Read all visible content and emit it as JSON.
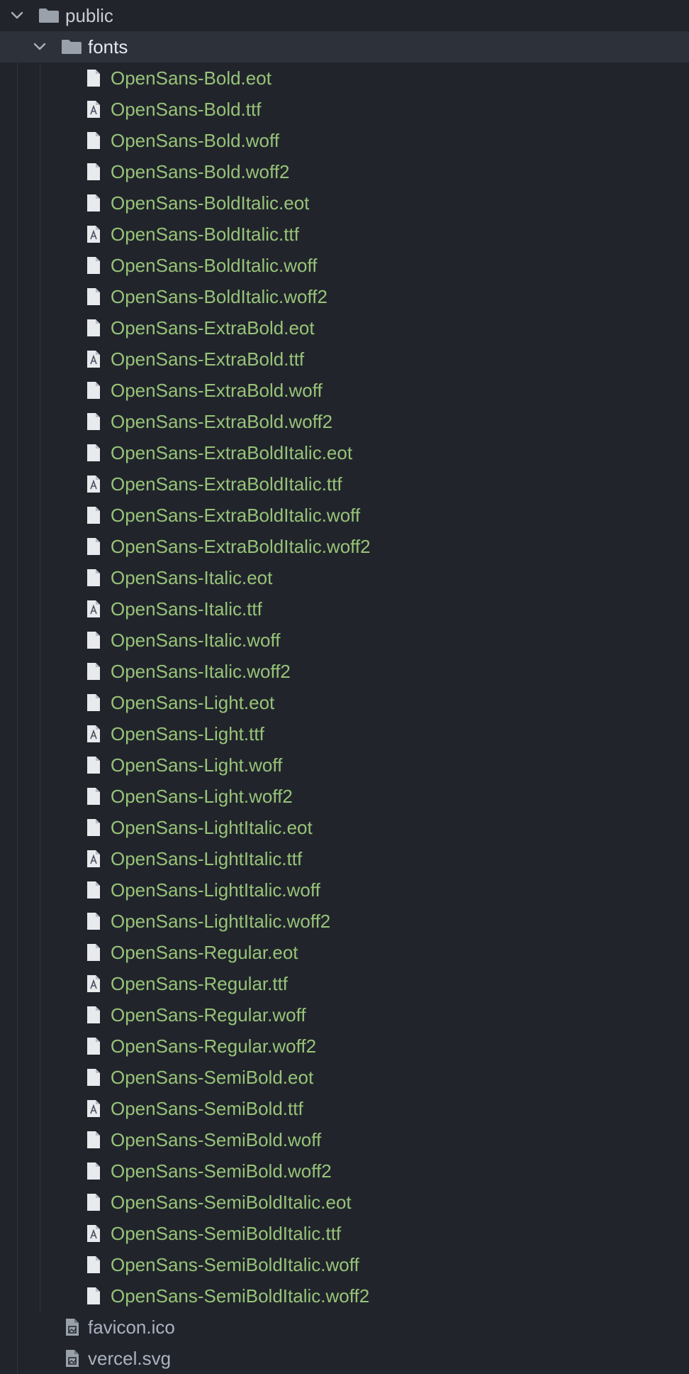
{
  "tree": {
    "root": {
      "label": "public",
      "expanded": true,
      "icon": "folder-icon"
    },
    "folder": {
      "label": "fonts",
      "expanded": true,
      "icon": "folder-icon"
    },
    "font_files": [
      {
        "name": "OpenSans-Bold.eot",
        "icon": "file-icon"
      },
      {
        "name": "OpenSans-Bold.ttf",
        "icon": "font-file-icon"
      },
      {
        "name": "OpenSans-Bold.woff",
        "icon": "file-icon"
      },
      {
        "name": "OpenSans-Bold.woff2",
        "icon": "file-icon"
      },
      {
        "name": "OpenSans-BoldItalic.eot",
        "icon": "file-icon"
      },
      {
        "name": "OpenSans-BoldItalic.ttf",
        "icon": "font-file-icon"
      },
      {
        "name": "OpenSans-BoldItalic.woff",
        "icon": "file-icon"
      },
      {
        "name": "OpenSans-BoldItalic.woff2",
        "icon": "file-icon"
      },
      {
        "name": "OpenSans-ExtraBold.eot",
        "icon": "file-icon"
      },
      {
        "name": "OpenSans-ExtraBold.ttf",
        "icon": "font-file-icon"
      },
      {
        "name": "OpenSans-ExtraBold.woff",
        "icon": "file-icon"
      },
      {
        "name": "OpenSans-ExtraBold.woff2",
        "icon": "file-icon"
      },
      {
        "name": "OpenSans-ExtraBoldItalic.eot",
        "icon": "file-icon"
      },
      {
        "name": "OpenSans-ExtraBoldItalic.ttf",
        "icon": "font-file-icon"
      },
      {
        "name": "OpenSans-ExtraBoldItalic.woff",
        "icon": "file-icon"
      },
      {
        "name": "OpenSans-ExtraBoldItalic.woff2",
        "icon": "file-icon"
      },
      {
        "name": "OpenSans-Italic.eot",
        "icon": "file-icon"
      },
      {
        "name": "OpenSans-Italic.ttf",
        "icon": "font-file-icon"
      },
      {
        "name": "OpenSans-Italic.woff",
        "icon": "file-icon"
      },
      {
        "name": "OpenSans-Italic.woff2",
        "icon": "file-icon"
      },
      {
        "name": "OpenSans-Light.eot",
        "icon": "file-icon"
      },
      {
        "name": "OpenSans-Light.ttf",
        "icon": "font-file-icon"
      },
      {
        "name": "OpenSans-Light.woff",
        "icon": "file-icon"
      },
      {
        "name": "OpenSans-Light.woff2",
        "icon": "file-icon"
      },
      {
        "name": "OpenSans-LightItalic.eot",
        "icon": "file-icon"
      },
      {
        "name": "OpenSans-LightItalic.ttf",
        "icon": "font-file-icon"
      },
      {
        "name": "OpenSans-LightItalic.woff",
        "icon": "file-icon"
      },
      {
        "name": "OpenSans-LightItalic.woff2",
        "icon": "file-icon"
      },
      {
        "name": "OpenSans-Regular.eot",
        "icon": "file-icon"
      },
      {
        "name": "OpenSans-Regular.ttf",
        "icon": "font-file-icon"
      },
      {
        "name": "OpenSans-Regular.woff",
        "icon": "file-icon"
      },
      {
        "name": "OpenSans-Regular.woff2",
        "icon": "file-icon"
      },
      {
        "name": "OpenSans-SemiBold.eot",
        "icon": "file-icon"
      },
      {
        "name": "OpenSans-SemiBold.ttf",
        "icon": "font-file-icon"
      },
      {
        "name": "OpenSans-SemiBold.woff",
        "icon": "file-icon"
      },
      {
        "name": "OpenSans-SemiBold.woff2",
        "icon": "file-icon"
      },
      {
        "name": "OpenSans-SemiBoldItalic.eot",
        "icon": "file-icon"
      },
      {
        "name": "OpenSans-SemiBoldItalic.ttf",
        "icon": "font-file-icon"
      },
      {
        "name": "OpenSans-SemiBoldItalic.woff",
        "icon": "file-icon"
      },
      {
        "name": "OpenSans-SemiBoldItalic.woff2",
        "icon": "file-icon"
      }
    ],
    "public_files": [
      {
        "name": "favicon.ico",
        "icon": "image-file-icon"
      },
      {
        "name": "vercel.svg",
        "icon": "image-file-icon"
      }
    ]
  },
  "colors": {
    "background": "#21252b",
    "selected_row": "#2c313a",
    "font_file_text": "#98c379",
    "folder_text": "#c8ccd4",
    "plain_file_text": "#abb2bf",
    "icon": "#aab0ba"
  }
}
